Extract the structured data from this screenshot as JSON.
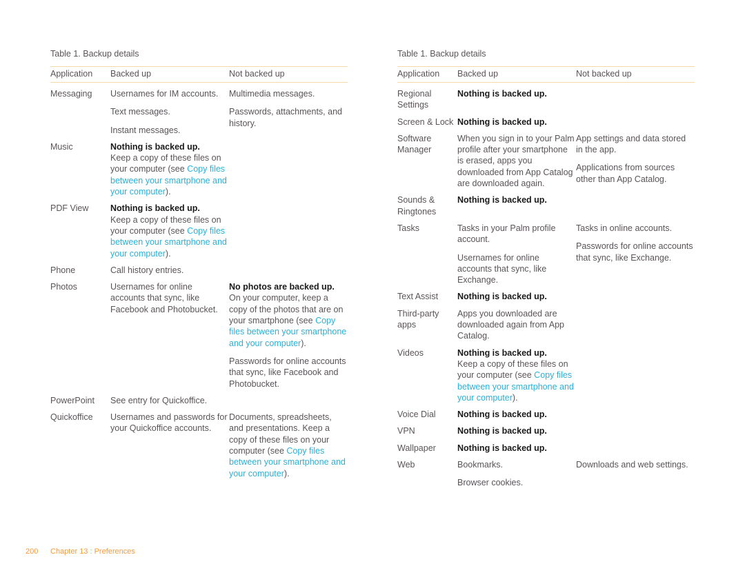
{
  "left": {
    "caption": "Table 1.  Backup details",
    "headers": [
      "Application",
      "Backed up",
      "Not backed up"
    ],
    "rows": [
      {
        "app": "Messaging",
        "backed": [
          "Usernames for IM accounts.",
          "Text messages.",
          "Instant messages."
        ],
        "not_backed": [
          "Multimedia messages.",
          "Passwords, attachments, and history."
        ]
      },
      {
        "app": "Music",
        "backed_bold": "Nothing is backed up.",
        "backed_pre": "Keep a copy of these files on your computer (see ",
        "backed_link": "Copy files between your smartphone and your computer",
        "backed_post": ")."
      },
      {
        "app": "PDF View",
        "backed_bold": "Nothing is backed up.",
        "backed_pre": "Keep a copy of these files on your computer (see ",
        "backed_link": "Copy files between your smartphone and your computer",
        "backed_post": ")."
      },
      {
        "app": "Phone",
        "backed": [
          "Call history entries."
        ]
      },
      {
        "app": "Photos",
        "backed": [
          "Usernames for online accounts that sync, like Facebook and Photobucket."
        ],
        "not_bold": "No photos are backed up.",
        "not_pre": "On your computer, keep a copy of the photos that are on your smartphone (see ",
        "not_link": "Copy files between your smartphone and your computer",
        "not_post": ").",
        "not_extra": "Passwords for online accounts that sync, like Facebook and Photobucket."
      },
      {
        "app": "PowerPoint",
        "backed": [
          "See entry for Quickoffice."
        ]
      },
      {
        "app": "Quickoffice",
        "backed": [
          "Usernames and passwords for your Quickoffice accounts."
        ],
        "not_pre": "Documents, spreadsheets, and presentations. Keep a copy of these files on your computer (see ",
        "not_link": "Copy files between your smartphone and your computer",
        "not_post": ")."
      }
    ]
  },
  "right": {
    "caption": "Table 1.  Backup details",
    "headers": [
      "Application",
      "Backed up",
      "Not backed up"
    ],
    "rows": [
      {
        "app": "Regional Settings",
        "backed_bold": "Nothing is backed up."
      },
      {
        "app": "Screen & Lock",
        "backed_bold": "Nothing is backed up."
      },
      {
        "app": "Software Manager",
        "backed": [
          "When you sign in to your Palm profile after your smartphone is erased, apps you downloaded from App Catalog are downloaded again."
        ],
        "not_backed": [
          "App settings and data stored in the app.",
          "Applications from sources other than App Catalog."
        ]
      },
      {
        "app": "Sounds & Ringtones",
        "backed_bold": "Nothing is backed up."
      },
      {
        "app": "Tasks",
        "backed": [
          "Tasks in your Palm profile account.",
          "Usernames for online accounts that sync, like Exchange."
        ],
        "not_backed": [
          "Tasks in online accounts.",
          "Passwords for online accounts that sync, like Exchange."
        ]
      },
      {
        "app": "Text Assist",
        "backed_bold": "Nothing is backed up."
      },
      {
        "app": "Third-party apps",
        "backed": [
          "Apps you downloaded are downloaded again from App Catalog."
        ]
      },
      {
        "app": "Videos",
        "backed_bold": "Nothing is backed up.",
        "backed_pre": "Keep a copy of these files on your computer (see ",
        "backed_link": "Copy files between your smartphone and your computer",
        "backed_post": ")."
      },
      {
        "app": "Voice Dial",
        "backed_bold": "Nothing is backed up."
      },
      {
        "app": "VPN",
        "backed_bold": "Nothing is backed up."
      },
      {
        "app": "Wallpaper",
        "backed_bold": "Nothing is backed up."
      },
      {
        "app": "Web",
        "backed": [
          "Bookmarks.",
          "Browser cookies."
        ],
        "not_backed": [
          "Downloads and web settings."
        ]
      }
    ]
  },
  "footer": {
    "page_number": "200",
    "chapter": "Chapter 13  :  Preferences"
  },
  "colors": {
    "text": "#5a5458",
    "bold_text": "#1a1a1a",
    "link": "#2ab0d9",
    "rule": "#f7d9a8",
    "footer": "#f39a3c"
  }
}
